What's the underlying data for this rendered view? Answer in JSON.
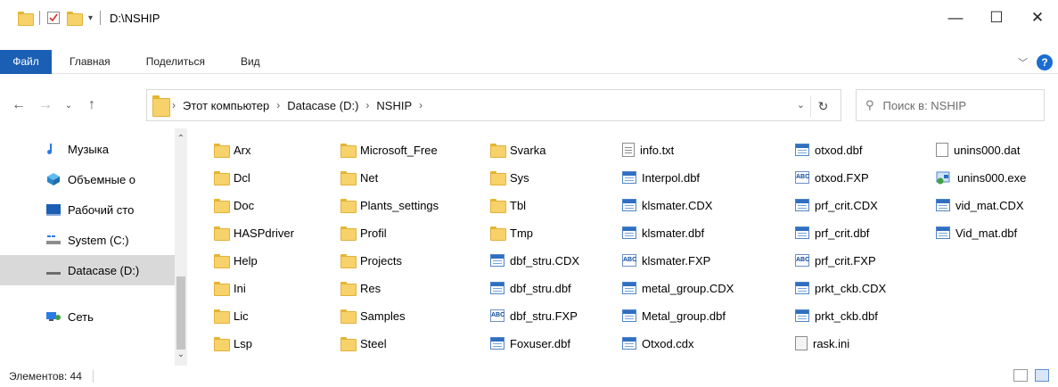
{
  "window": {
    "title": "D:\\NSHIP",
    "controls": {
      "minimize": "—",
      "maximize": "☐",
      "close": "✕"
    }
  },
  "ribbon": {
    "tabs": [
      "Файл",
      "Главная",
      "Поделиться",
      "Вид"
    ],
    "help": "?"
  },
  "address": {
    "crumbs": [
      "Этот компьютер",
      "Datacase (D:)",
      "NSHIP"
    ],
    "search_placeholder": "Поиск в: NSHIP"
  },
  "nav_pane": {
    "items": [
      {
        "label": "Музыка",
        "icon": "music-icon"
      },
      {
        "label": "Объемные о",
        "icon": "3d-objects-icon"
      },
      {
        "label": "Рабочий сто",
        "icon": "desktop-icon"
      },
      {
        "label": "System (C:)",
        "icon": "drive-icon"
      },
      {
        "label": "Datacase (D:)",
        "icon": "drive-icon",
        "selected": true
      },
      {
        "label": "Сеть",
        "icon": "network-icon"
      }
    ]
  },
  "files": {
    "columns": [
      [
        {
          "name": "Arx",
          "type": "folder"
        },
        {
          "name": "Dcl",
          "type": "folder"
        },
        {
          "name": "Doc",
          "type": "folder"
        },
        {
          "name": "HASPdriver",
          "type": "folder"
        },
        {
          "name": "Help",
          "type": "folder"
        },
        {
          "name": "Ini",
          "type": "folder"
        },
        {
          "name": "Lic",
          "type": "folder"
        },
        {
          "name": "Lsp",
          "type": "folder"
        }
      ],
      [
        {
          "name": "Microsoft_Free",
          "type": "folder"
        },
        {
          "name": "Net",
          "type": "folder"
        },
        {
          "name": "Plants_settings",
          "type": "folder"
        },
        {
          "name": "Profil",
          "type": "folder"
        },
        {
          "name": "Projects",
          "type": "folder"
        },
        {
          "name": "Res",
          "type": "folder"
        },
        {
          "name": "Samples",
          "type": "folder"
        },
        {
          "name": "Steel",
          "type": "folder"
        }
      ],
      [
        {
          "name": "Svarka",
          "type": "folder"
        },
        {
          "name": "Sys",
          "type": "folder"
        },
        {
          "name": "Tbl",
          "type": "folder"
        },
        {
          "name": "Tmp",
          "type": "folder"
        },
        {
          "name": "dbf_stru.CDX",
          "type": "db"
        },
        {
          "name": "dbf_stru.dbf",
          "type": "db"
        },
        {
          "name": "dbf_stru.FXP",
          "type": "abc"
        },
        {
          "name": "Foxuser.dbf",
          "type": "db"
        }
      ],
      [
        {
          "name": "info.txt",
          "type": "txt"
        },
        {
          "name": "Interpol.dbf",
          "type": "db"
        },
        {
          "name": "klsmater.CDX",
          "type": "db"
        },
        {
          "name": "klsmater.dbf",
          "type": "db"
        },
        {
          "name": "klsmater.FXP",
          "type": "abc"
        },
        {
          "name": "metal_group.CDX",
          "type": "db"
        },
        {
          "name": "Metal_group.dbf",
          "type": "db"
        },
        {
          "name": "Otxod.cdx",
          "type": "db"
        }
      ],
      [
        {
          "name": "otxod.dbf",
          "type": "db"
        },
        {
          "name": "otxod.FXP",
          "type": "abc"
        },
        {
          "name": "prf_crit.CDX",
          "type": "db"
        },
        {
          "name": "prf_crit.dbf",
          "type": "db"
        },
        {
          "name": "prf_crit.FXP",
          "type": "abc"
        },
        {
          "name": "prkt_ckb.CDX",
          "type": "db"
        },
        {
          "name": "prkt_ckb.dbf",
          "type": "db"
        },
        {
          "name": "rask.ini",
          "type": "ini"
        }
      ],
      [
        {
          "name": "unins000.dat",
          "type": "blank"
        },
        {
          "name": "unins000.exe",
          "type": "exe"
        },
        {
          "name": "vid_mat.CDX",
          "type": "db"
        },
        {
          "name": "Vid_mat.dbf",
          "type": "db"
        }
      ]
    ]
  },
  "status": {
    "text": "Элементов: 44"
  },
  "colors": {
    "accent": "#1a5fb4",
    "folder": "#f7d26a",
    "selection": "#d9d9d9"
  }
}
